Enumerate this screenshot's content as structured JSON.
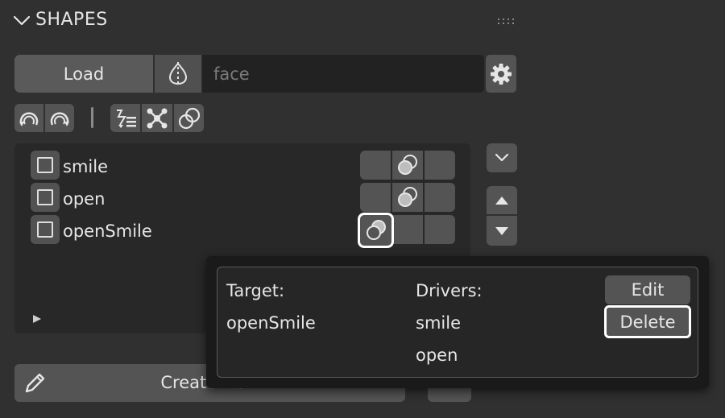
{
  "panel": {
    "title": "SHAPES"
  },
  "toolbar": {
    "load_label": "Load",
    "name_placeholder": "face"
  },
  "shapes": [
    {
      "name": "smile"
    },
    {
      "name": "open"
    },
    {
      "name": "openSmile"
    }
  ],
  "footer": {
    "create_label": "Create New"
  },
  "popup": {
    "target_label": "Target:",
    "target_value": "openSmile",
    "drivers_label": "Drivers:",
    "drivers": [
      "smile",
      "open"
    ],
    "edit_label": "Edit",
    "delete_label": "Delete"
  }
}
